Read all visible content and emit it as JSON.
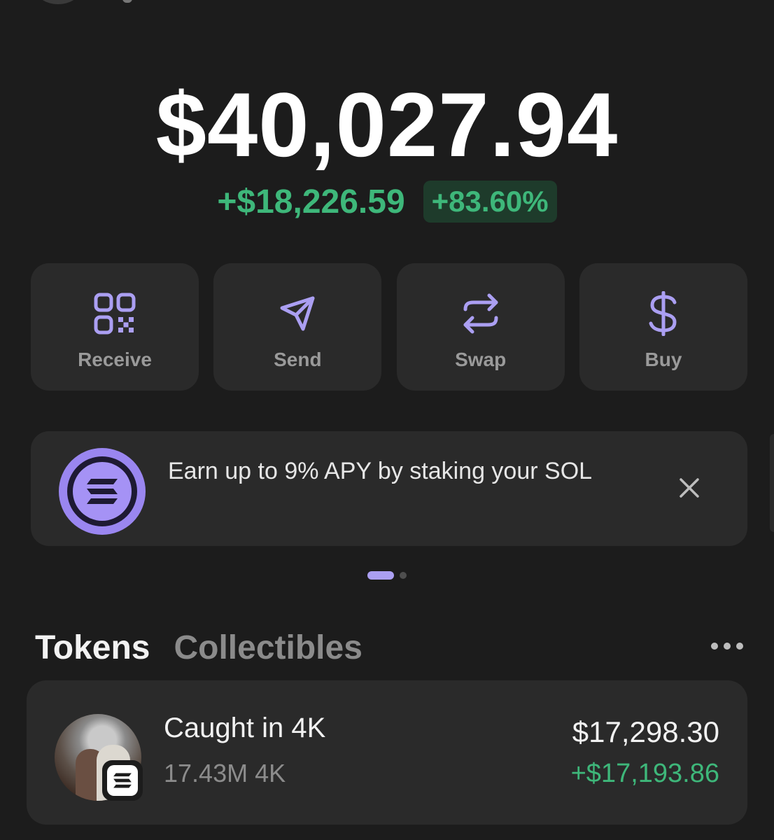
{
  "portfolio": {
    "balance": "$40,027.94",
    "change_amount": "+$18,226.59",
    "change_percent": "+83.60%"
  },
  "actions": [
    {
      "label": "Receive",
      "icon": "qr-code-icon"
    },
    {
      "label": "Send",
      "icon": "send-icon"
    },
    {
      "label": "Swap",
      "icon": "swap-icon"
    },
    {
      "label": "Buy",
      "icon": "dollar-icon"
    }
  ],
  "banner": {
    "text": "Earn up to 9% APY by staking your SOL",
    "icon": "solana-logo-icon"
  },
  "pager": {
    "count": 2,
    "active": 0
  },
  "tabs": {
    "tokens": "Tokens",
    "collectibles": "Collectibles",
    "active": "Tokens"
  },
  "tokens": [
    {
      "name": "Caught in 4K",
      "amount": "17.43M 4K",
      "value": "$17,298.30",
      "change": "+$17,193.86"
    }
  ],
  "colors": {
    "background": "#1c1c1c",
    "card": "#2a2a2a",
    "positive": "#3eb77a",
    "accent": "#ab9ff2"
  }
}
